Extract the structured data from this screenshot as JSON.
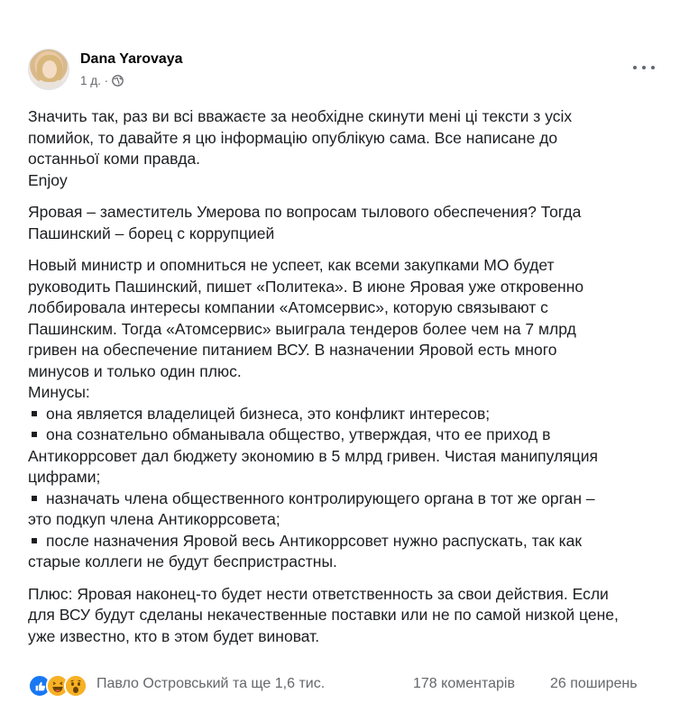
{
  "post": {
    "author": "Dana Yarovaya",
    "time": "1 д. ·",
    "paragraphs_intro": [
      "Значить так, раз ви всі вважаєте за необхідне скинути мені ці тексти з усіх",
      "помийок, то давайте я цю інформацію опублікую сама. Все написане до",
      "останньої коми правда.",
      "Enjoy"
    ],
    "headline": [
      "Яровая – заместитель Умерова по вопросам тылового обеспечения? Тогда",
      "Пашинский – борец с коррупцией"
    ],
    "body_lines": [
      "Новый министр и опомниться не успеет, как всеми закупками МО будет",
      "руководить Пашинский, пишет «Политека». В июне Яровая уже откровенно",
      "лоббировала интересы компании «Атомсервис», которую связывают с",
      "Пашинским. Тогда «Атомсервис» выиграла тендеров более чем на 7 млрд",
      "гривен на обеспечение питанием ВСУ. В назначении Яровой есть много",
      "минусов и только один плюс.",
      "Минусы:"
    ],
    "bullets": [
      [
        "она является владелицей бизнеса, это конфликт интересов;"
      ],
      [
        "она сознательно обманывала общество, утверждая, что ее приход в",
        "Антикоррсовет дал бюджету экономию в 5 млрд гривен. Чистая манипуляция",
        "цифрами;"
      ],
      [
        "назначать члена общественного контролирующего органа в тот же орган –",
        "это подкуп члена Антикоррсовета;"
      ],
      [
        "после назначения Яровой весь Антикоррсовет нужно распускать, так как",
        "старые коллеги не будут беспристрастны."
      ]
    ],
    "conclusion": [
      "Плюс: Яровая наконец-то будет нести ответственность за свои действия. Если",
      "для ВСУ будут сделаны некачественные поставки или не по самой низкой цене,",
      "уже известно, кто в этом будет виноват."
    ]
  },
  "footer": {
    "reactions": [
      "like-icon",
      "haha-icon",
      "wow-icon"
    ],
    "likes_text": "Павло Островський та ще 1,6 тис.",
    "comments_text": "178 коментарів",
    "shares_text": "26 поширень"
  },
  "colors": {
    "like": "#1877f2",
    "emoji": "#f7b125",
    "text": "#1c1e21",
    "muted": "#65676b"
  }
}
